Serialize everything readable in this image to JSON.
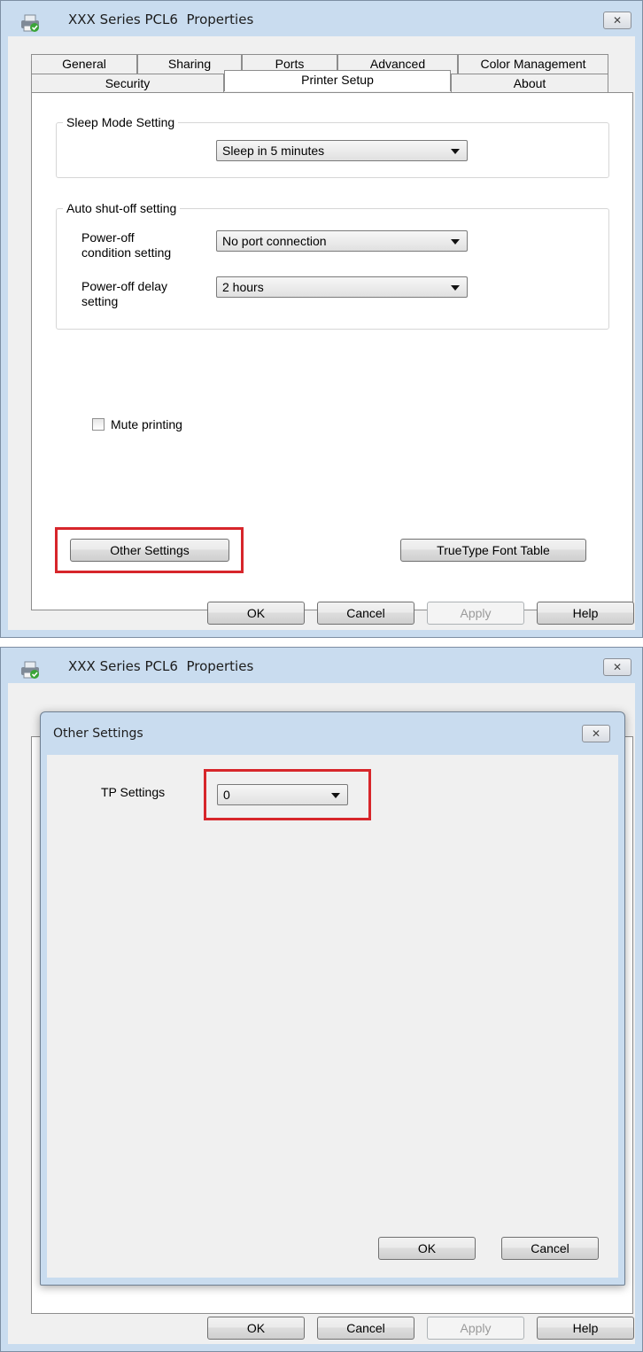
{
  "window1": {
    "title": "XXX Series PCL6  Properties",
    "close_glyph": "✕",
    "icon": "printer-icon",
    "tabs_row1": [
      "General",
      "Sharing",
      "Ports",
      "Advanced",
      "Color Management"
    ],
    "tabs_row2": [
      "Security",
      "Printer Setup",
      "About"
    ],
    "active_tab": "Printer Setup",
    "sleep_group": {
      "label": "Sleep Mode Setting",
      "value": "Sleep in 5 minutes"
    },
    "auto_group": {
      "label": "Auto shut-off setting",
      "condition_label_1": "Power-off",
      "condition_label_2": "condition setting",
      "condition_value": "No port connection",
      "delay_label_1": "Power-off delay",
      "delay_label_2": "setting",
      "delay_value": "2 hours"
    },
    "mute_label": "Mute printing",
    "mute_checked": false,
    "other_settings_label": "Other Settings",
    "truetype_label": "TrueType Font Table",
    "buttons": {
      "ok": "OK",
      "cancel": "Cancel",
      "apply": "Apply",
      "help": "Help"
    }
  },
  "window2": {
    "title": "XXX Series PCL6  Properties",
    "close_glyph": "✕",
    "dialog": {
      "title": "Other Settings",
      "close_glyph": "✕",
      "tp_label": "TP Settings",
      "tp_value": "0",
      "ok": "OK",
      "cancel": "Cancel"
    },
    "buttons": {
      "ok": "OK",
      "cancel": "Cancel",
      "apply": "Apply",
      "help": "Help"
    }
  },
  "colors": {
    "frame": "#c9dcef",
    "client": "#f0f0f0",
    "highlight": "#d7262b"
  }
}
